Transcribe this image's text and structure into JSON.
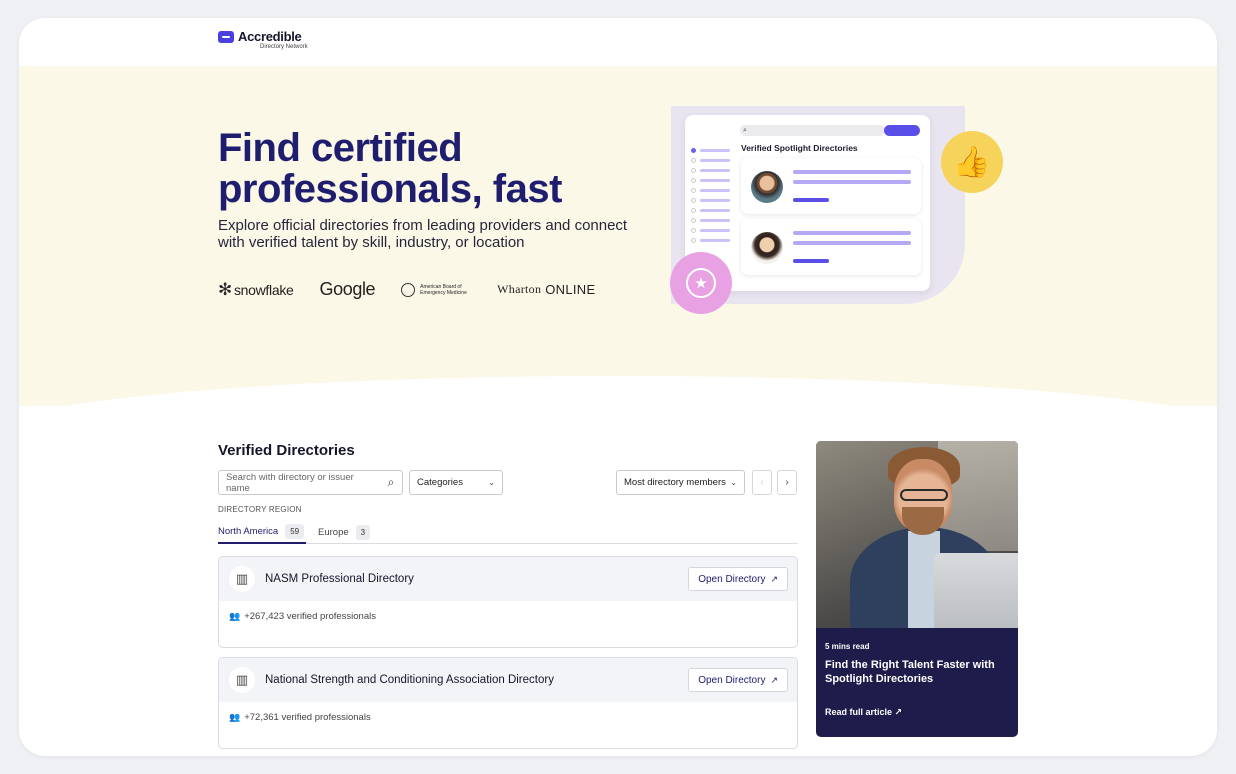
{
  "header": {
    "logo_name": "Accredible",
    "logo_sub": "Directory Network"
  },
  "hero": {
    "title_line1": "Find certified",
    "title_line2": "professionals, fast",
    "subtitle": "Explore official directories from leading providers and connect with verified talent by skill, industry, or location",
    "partners": {
      "snowflake": "snowflake",
      "google": "Google",
      "abem": "American Board of Emergency Medicine",
      "wharton_name": "Wharton",
      "wharton_suffix": "ONLINE"
    },
    "mock": {
      "title": "Verified Spotlight Directories",
      "search_icon": "search-icon"
    }
  },
  "directories": {
    "title": "Verified Directories",
    "search_placeholder": "Search with directory or issuer name",
    "categories_label": "Categories",
    "sort_label": "Most directory members",
    "region_label": "DIRECTORY REGION",
    "tabs": [
      {
        "label": "North America",
        "count": "59"
      },
      {
        "label": "Europe",
        "count": "3"
      }
    ],
    "open_label": "Open Directory",
    "items": [
      {
        "name": "NASM Professional Directory",
        "members": "+267,423 verified professionals"
      },
      {
        "name": "National Strength and Conditioning Association Directory",
        "members": "+72,361 verified professionals"
      }
    ]
  },
  "article": {
    "read_time": "5 mins read",
    "title": "Find the Right Talent Faster with Spotlight Directories",
    "link": "Read full article"
  },
  "colors": {
    "brand": "#1f1d6e",
    "accent": "#4b3fe0",
    "hero_bg": "#fcf8e7"
  }
}
